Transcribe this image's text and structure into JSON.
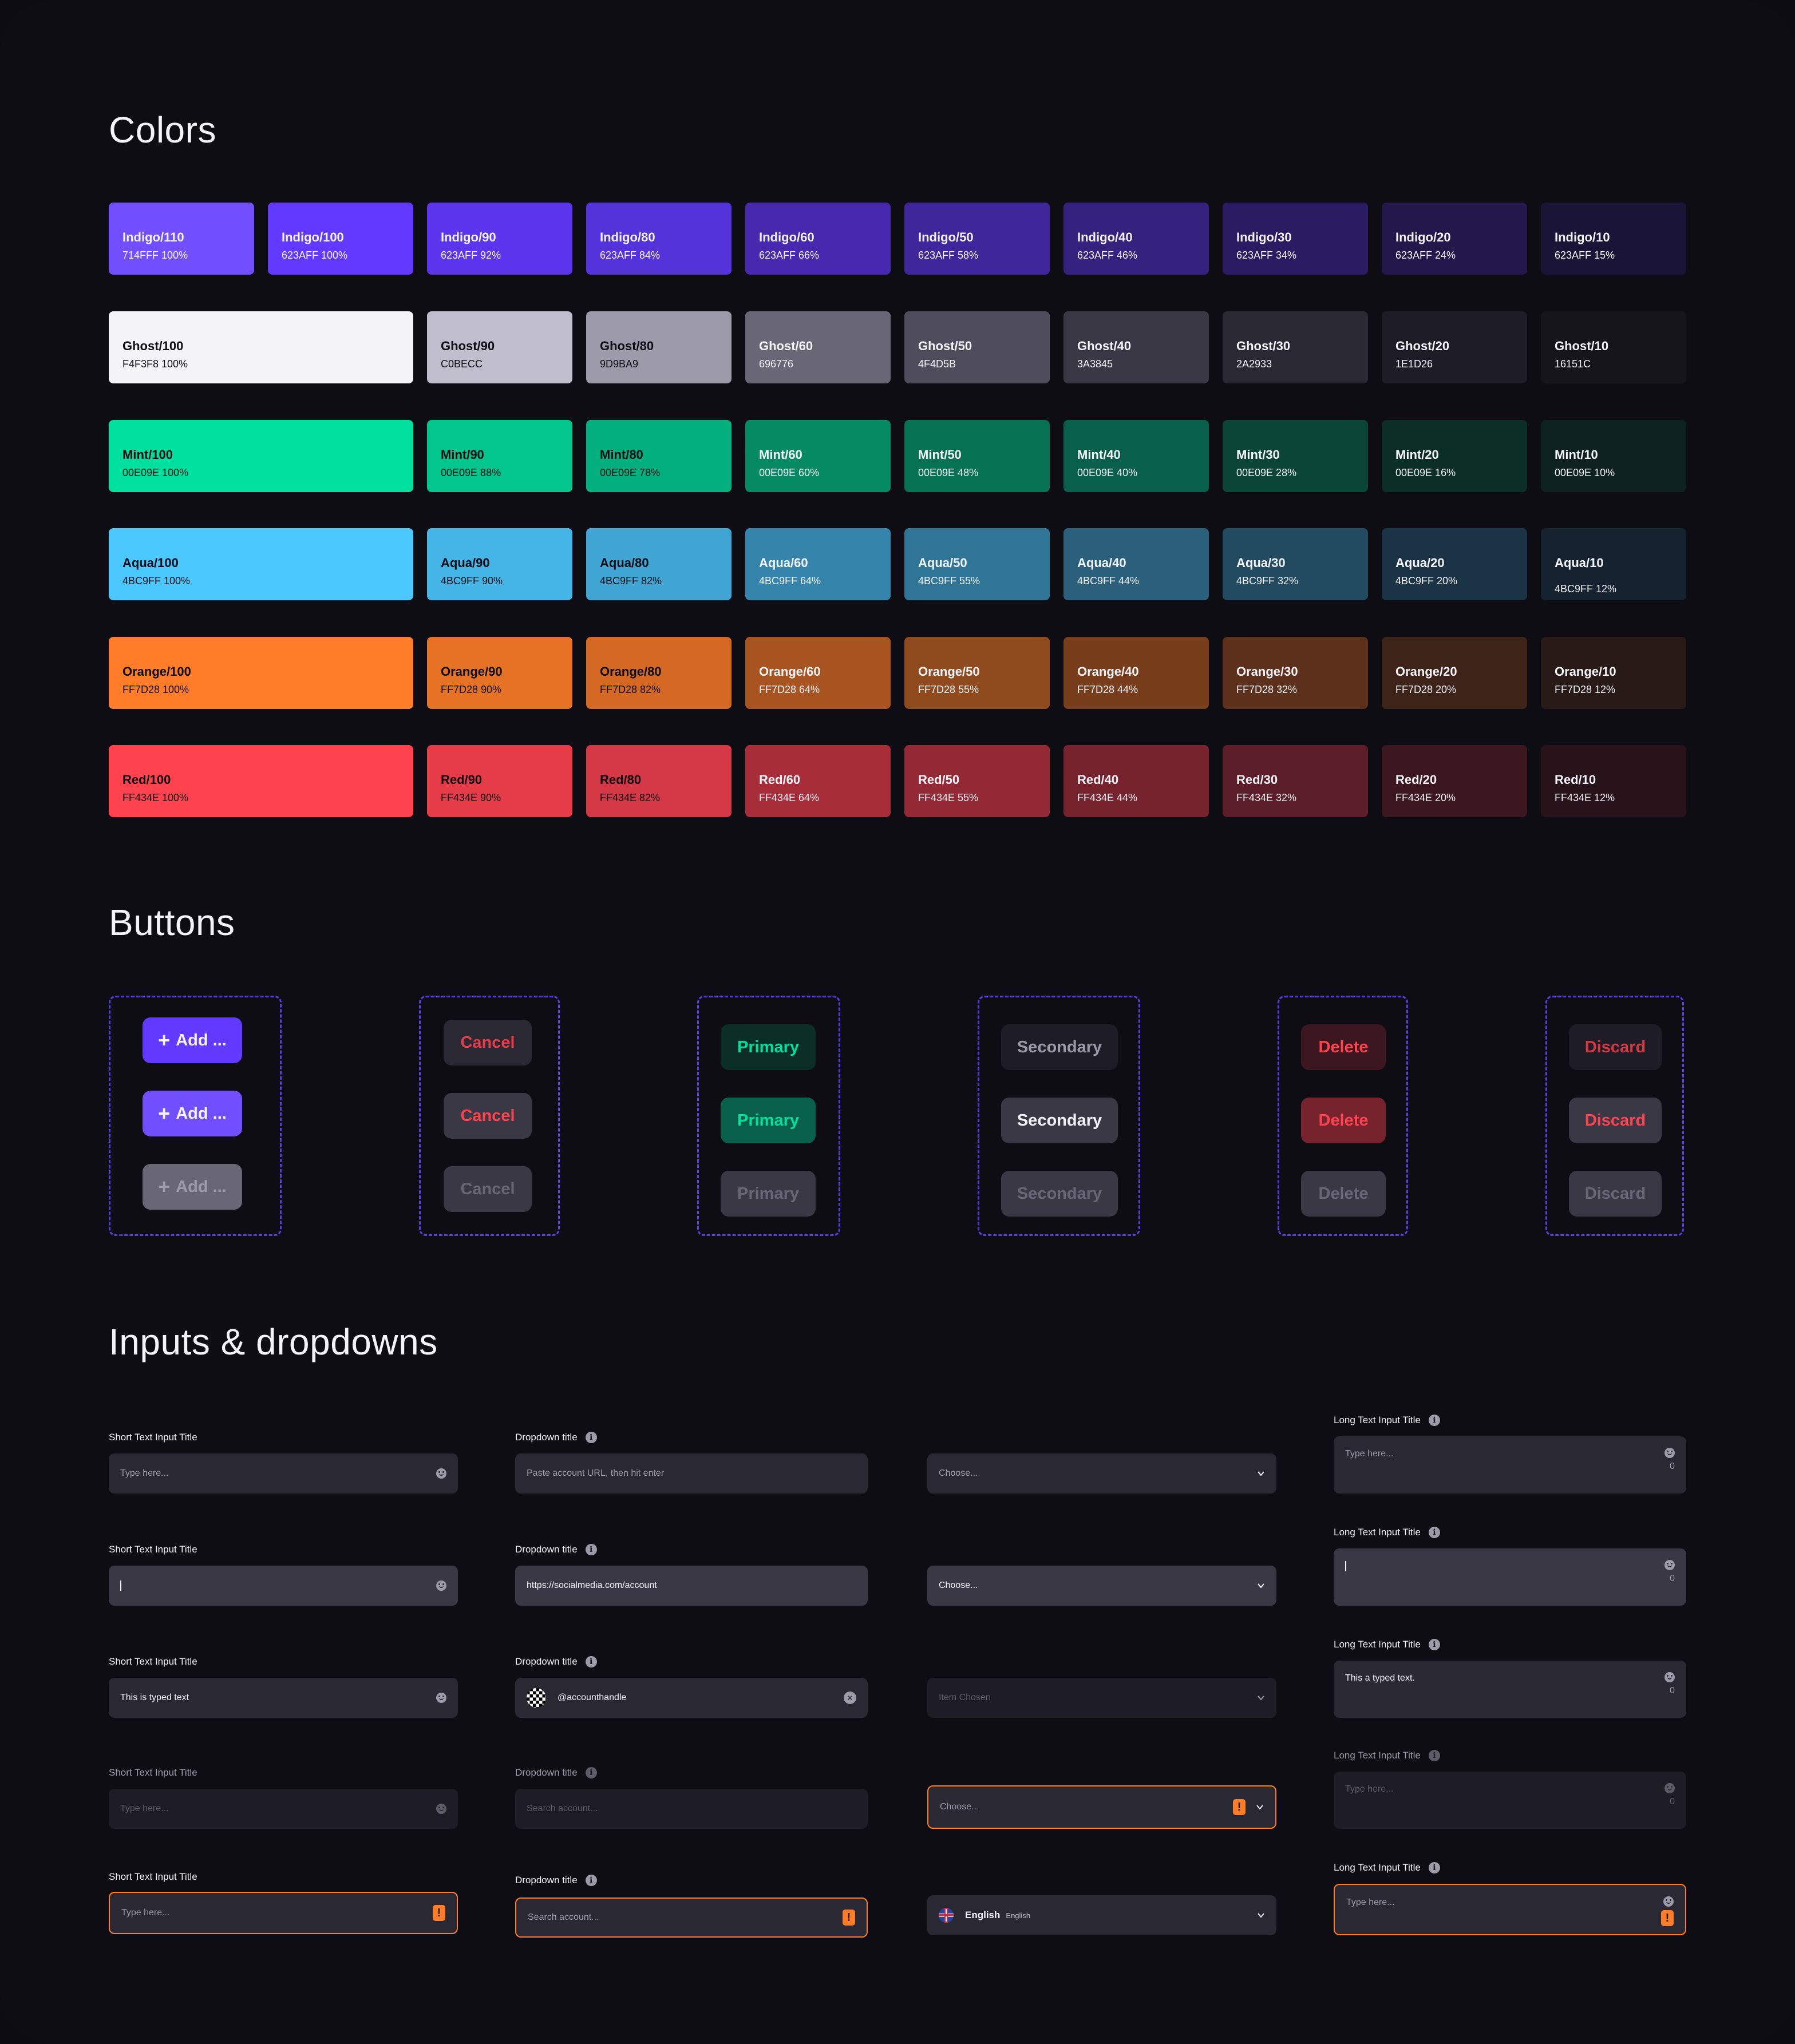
{
  "sections": {
    "colors_title": "Colors",
    "buttons_title": "Buttons",
    "inputs_title": "Inputs & dropdowns"
  },
  "color_rows": [
    {
      "family": "Indigo",
      "wide_first": false,
      "swatches": [
        {
          "name": "Indigo/110",
          "code": "714FFF 100%",
          "hex": "#714FFF",
          "text": "#f4f3f8"
        },
        {
          "name": "Indigo/100",
          "code": "623AFF 100%",
          "hex": "#623AFF",
          "text": "#f4f3f8"
        },
        {
          "name": "Indigo/90",
          "code": "623AFF 92%",
          "hex": "#5C36EE",
          "text": "#f4f3f8"
        },
        {
          "name": "Indigo/80",
          "code": "623AFF 84%",
          "hex": "#5433DB",
          "text": "#f4f3f8"
        },
        {
          "name": "Indigo/60",
          "code": "623AFF 66%",
          "hex": "#4629AE",
          "text": "#f4f3f8"
        },
        {
          "name": "Indigo/50",
          "code": "623AFF 58%",
          "hex": "#3F279B",
          "text": "#f4f3f8"
        },
        {
          "name": "Indigo/40",
          "code": "623AFF 46%",
          "hex": "#35217E",
          "text": "#f4f3f8"
        },
        {
          "name": "Indigo/30",
          "code": "623AFF 34%",
          "hex": "#2A1C62",
          "text": "#f4f3f8"
        },
        {
          "name": "Indigo/20",
          "code": "623AFF 24%",
          "hex": "#22184B",
          "text": "#f4f3f8"
        },
        {
          "name": "Indigo/10",
          "code": "623AFF 15%",
          "hex": "#1A1436",
          "text": "#f4f3f8"
        }
      ]
    },
    {
      "family": "Ghost",
      "wide_first": true,
      "swatches": [
        {
          "name": "Ghost/100",
          "code": "F4F3F8 100%",
          "hex": "#F4F3F8",
          "text": "#0d0d13"
        },
        {
          "name": "Ghost/90",
          "code": "C0BECC",
          "hex": "#C0BECC",
          "text": "#0d0d13"
        },
        {
          "name": "Ghost/80",
          "code": "9D9BA9",
          "hex": "#9D9BA9",
          "text": "#0d0d13"
        },
        {
          "name": "Ghost/60",
          "code": "696776",
          "hex": "#696776",
          "text": "#f4f3f8"
        },
        {
          "name": "Ghost/50",
          "code": "4F4D5B",
          "hex": "#4F4D5B",
          "text": "#f4f3f8"
        },
        {
          "name": "Ghost/40",
          "code": "3A3845",
          "hex": "#3A3845",
          "text": "#f4f3f8"
        },
        {
          "name": "Ghost/30",
          "code": "2A2933",
          "hex": "#2A2933",
          "text": "#f4f3f8"
        },
        {
          "name": "Ghost/20",
          "code": "1E1D26",
          "hex": "#1E1D26",
          "text": "#f4f3f8"
        },
        {
          "name": "Ghost/10",
          "code": "16151C",
          "hex": "#16151C",
          "text": "#f4f3f8"
        }
      ]
    },
    {
      "family": "Mint",
      "wide_first": true,
      "swatches": [
        {
          "name": "Mint/100",
          "code": "00E09E 100%",
          "hex": "#00E09E",
          "text": "#0d0d13"
        },
        {
          "name": "Mint/90",
          "code": "00E09E 88%",
          "hex": "#02C68C",
          "text": "#0d0d13"
        },
        {
          "name": "Mint/80",
          "code": "00E09E 78%",
          "hex": "#04B17E",
          "text": "#0d0d13"
        },
        {
          "name": "Mint/60",
          "code": "00E09E 60%",
          "hex": "#058A64",
          "text": "#f4f3f8"
        },
        {
          "name": "Mint/50",
          "code": "00E09E 48%",
          "hex": "#077153",
          "text": "#f4f3f8"
        },
        {
          "name": "Mint/40",
          "code": "00E09E 40%",
          "hex": "#08604A",
          "text": "#f4f3f8"
        },
        {
          "name": "Mint/30",
          "code": "00E09E 28%",
          "hex": "#0A4537",
          "text": "#f4f3f8"
        },
        {
          "name": "Mint/20",
          "code": "00E09E 16%",
          "hex": "#0B2E26",
          "text": "#f4f3f8"
        },
        {
          "name": "Mint/10",
          "code": "00E09E 10%",
          "hex": "#0D2120",
          "text": "#f4f3f8"
        }
      ]
    },
    {
      "family": "Aqua",
      "wide_first": true,
      "swatches": [
        {
          "name": "Aqua/100",
          "code": "4BC9FF 100%",
          "hex": "#4BC9FF",
          "text": "#0d0d13"
        },
        {
          "name": "Aqua/90",
          "code": "4BC9FF 90%",
          "hex": "#45B4E6",
          "text": "#0d0d13"
        },
        {
          "name": "Aqua/80",
          "code": "4BC9FF 82%",
          "hex": "#41A6D4",
          "text": "#0d0d13"
        },
        {
          "name": "Aqua/60",
          "code": "4BC9FF 64%",
          "hex": "#3484AB",
          "text": "#f4f3f8"
        },
        {
          "name": "Aqua/50",
          "code": "4BC9FF 55%",
          "hex": "#2F7596",
          "text": "#f4f3f8"
        },
        {
          "name": "Aqua/40",
          "code": "4BC9FF 44%",
          "hex": "#2A607B",
          "text": "#f4f3f8"
        },
        {
          "name": "Aqua/30",
          "code": "4BC9FF 32%",
          "hex": "#224A61",
          "text": "#f4f3f8"
        },
        {
          "name": "Aqua/20",
          "code": "4BC9FF 20%",
          "hex": "#1B3445",
          "text": "#f4f3f8"
        },
        {
          "name": "Aqua/10",
          "code": "4BC9FF 12%",
          "hex": "#152330",
          "text": "#f4f3f8"
        }
      ]
    },
    {
      "family": "Orange",
      "wide_first": true,
      "swatches": [
        {
          "name": "Orange/100",
          "code": "FF7D28 100%",
          "hex": "#FF7D28",
          "text": "#0d0d13"
        },
        {
          "name": "Orange/90",
          "code": "FF7D28 90%",
          "hex": "#E67226",
          "text": "#0d0d13"
        },
        {
          "name": "Orange/80",
          "code": "FF7D28 82%",
          "hex": "#D56924",
          "text": "#0d0d13"
        },
        {
          "name": "Orange/60",
          "code": "FF7D28 64%",
          "hex": "#A85420",
          "text": "#f4f3f8"
        },
        {
          "name": "Orange/50",
          "code": "FF7D28 55%",
          "hex": "#8F4A1E",
          "text": "#f4f3f8"
        },
        {
          "name": "Orange/40",
          "code": "FF7D28 44%",
          "hex": "#783E1C",
          "text": "#f4f3f8"
        },
        {
          "name": "Orange/30",
          "code": "FF7D28 32%",
          "hex": "#5C301A",
          "text": "#f4f3f8"
        },
        {
          "name": "Orange/20",
          "code": "FF7D28 20%",
          "hex": "#3D2318",
          "text": "#f4f3f8"
        },
        {
          "name": "Orange/10",
          "code": "FF7D28 12%",
          "hex": "#281B17",
          "text": "#f4f3f8"
        }
      ]
    },
    {
      "family": "Red",
      "wide_first": true,
      "swatches": [
        {
          "name": "Red/100",
          "code": "FF434E 100%",
          "hex": "#FF434E",
          "text": "#0d0d13"
        },
        {
          "name": "Red/90",
          "code": "FF434E 90%",
          "hex": "#E53C48",
          "text": "#0d0d13"
        },
        {
          "name": "Red/80",
          "code": "FF434E 82%",
          "hex": "#D43844",
          "text": "#0d0d13"
        },
        {
          "name": "Red/60",
          "code": "FF434E 64%",
          "hex": "#A72D39",
          "text": "#f4f3f8"
        },
        {
          "name": "Red/50",
          "code": "FF434E 55%",
          "hex": "#922934",
          "text": "#f4f3f8"
        },
        {
          "name": "Red/40",
          "code": "FF434E 44%",
          "hex": "#77232E",
          "text": "#f4f3f8"
        },
        {
          "name": "Red/30",
          "code": "FF434E 32%",
          "hex": "#5B1D27",
          "text": "#f4f3f8"
        },
        {
          "name": "Red/20",
          "code": "FF434E 20%",
          "hex": "#3D1720",
          "text": "#f4f3f8"
        },
        {
          "name": "Red/10",
          "code": "FF434E 12%",
          "hex": "#29131B",
          "text": "#f4f3f8"
        }
      ]
    }
  ],
  "button_groups": [
    {
      "name": "add",
      "label": "Add ...",
      "has_plus": true,
      "states": [
        {
          "state": "default",
          "bg": "#623AFF",
          "fg": "#f4f3f8"
        },
        {
          "state": "hover",
          "bg": "#714FFF",
          "fg": "#f4f3f8"
        },
        {
          "state": "disabled",
          "bg": "#696776",
          "fg": "#9d9ba9"
        }
      ]
    },
    {
      "name": "cancel",
      "label": "Cancel",
      "has_plus": false,
      "states": [
        {
          "state": "default",
          "bg": "#2A2933",
          "fg": "#E53C48"
        },
        {
          "state": "hover",
          "bg": "#3A3845",
          "fg": "#FF434E"
        },
        {
          "state": "disabled",
          "bg": "#3A3845",
          "fg": "#696776"
        }
      ]
    },
    {
      "name": "primary",
      "label": "Primary",
      "has_plus": false,
      "states": [
        {
          "state": "default",
          "bg": "#0B2E26",
          "fg": "#00E09E"
        },
        {
          "state": "hover",
          "bg": "#08604A",
          "fg": "#00E09E"
        },
        {
          "state": "disabled",
          "bg": "#3A3845",
          "fg": "#696776"
        }
      ]
    },
    {
      "name": "secondary",
      "label": "Secondary",
      "has_plus": false,
      "states": [
        {
          "state": "default",
          "bg": "#1E1D26",
          "fg": "#9D9BA9"
        },
        {
          "state": "hover",
          "bg": "#3A3845",
          "fg": "#F4F3F8"
        },
        {
          "state": "disabled",
          "bg": "#3A3845",
          "fg": "#696776"
        }
      ]
    },
    {
      "name": "delete",
      "label": "Delete",
      "has_plus": false,
      "states": [
        {
          "state": "default",
          "bg": "#3D1720",
          "fg": "#FF434E"
        },
        {
          "state": "hover",
          "bg": "#77232E",
          "fg": "#FF434E"
        },
        {
          "state": "disabled",
          "bg": "#3A3845",
          "fg": "#696776"
        }
      ]
    },
    {
      "name": "discard",
      "label": "Discard",
      "has_plus": false,
      "states": [
        {
          "state": "default",
          "bg": "#1E1D26",
          "fg": "#D43844"
        },
        {
          "state": "hover",
          "bg": "#3A3845",
          "fg": "#FF434E"
        },
        {
          "state": "disabled",
          "bg": "#3A3845",
          "fg": "#696776"
        }
      ]
    }
  ],
  "inputs": {
    "short_text": [
      {
        "label": "Short Text Input Title",
        "state": "default",
        "placeholder": "Type here...",
        "value": "",
        "icon": "emoji"
      },
      {
        "label": "Short Text Input Title",
        "state": "active",
        "placeholder": "",
        "value": "",
        "caret": true,
        "icon": "emoji"
      },
      {
        "label": "Short Text Input Title",
        "state": "filled",
        "placeholder": "",
        "value": "This is typed text",
        "icon": "emoji"
      },
      {
        "label": "Short Text Input Title",
        "state": "disabled",
        "placeholder": "Type here...",
        "value": "",
        "icon": "emoji"
      },
      {
        "label": "Short Text Input Title",
        "state": "error",
        "placeholder": "Type here...",
        "value": "",
        "icon": "warning"
      }
    ],
    "account_dropdown": [
      {
        "label": "Dropdown title",
        "state": "default",
        "placeholder": "Paste account URL, then hit enter",
        "value": ""
      },
      {
        "label": "Dropdown title",
        "state": "active",
        "placeholder": "",
        "value": "https://socialmedia.com/account"
      },
      {
        "label": "Dropdown title",
        "state": "selected",
        "placeholder": "",
        "value": "@accounthandle",
        "avatar": true,
        "clear": true
      },
      {
        "label": "Dropdown title",
        "state": "disabled",
        "placeholder": "Search account...",
        "value": ""
      },
      {
        "label": "Dropdown title",
        "state": "error",
        "placeholder": "Search account...",
        "value": "",
        "icon": "warning"
      }
    ],
    "select": [
      {
        "state": "default",
        "placeholder": "Choose...",
        "value": ""
      },
      {
        "state": "active",
        "placeholder": "",
        "value": "Choose..."
      },
      {
        "state": "disabled",
        "placeholder": "Item Chosen",
        "value": ""
      },
      {
        "state": "error",
        "placeholder": "Choose...",
        "value": "",
        "icon": "warning"
      },
      {
        "state": "language",
        "value": "English",
        "sub": "English",
        "flag": "uk-flag"
      }
    ],
    "long_text": [
      {
        "label": "Long Text Input Title",
        "state": "default",
        "placeholder": "Type here...",
        "value": "",
        "counter": "0"
      },
      {
        "label": "Long Text Input Title",
        "state": "active",
        "placeholder": "",
        "value": "",
        "caret": true,
        "counter": "0"
      },
      {
        "label": "Long Text Input Title",
        "state": "filled",
        "placeholder": "",
        "value": "This a typed text.",
        "counter": "0"
      },
      {
        "label": "Long Text Input Title",
        "state": "disabled",
        "placeholder": "Type here...",
        "value": "",
        "counter": "0"
      },
      {
        "label": "Long Text Input Title",
        "state": "error",
        "placeholder": "Type here...",
        "value": "",
        "icon": "warning"
      }
    ]
  },
  "theme": {
    "background": "#0D0D13",
    "accent": "#623AFF",
    "error": "#FF7D28"
  }
}
